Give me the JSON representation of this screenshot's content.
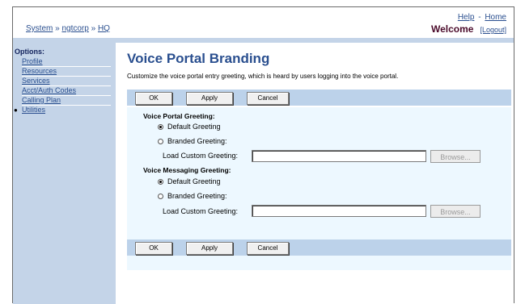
{
  "header": {
    "help": "Help",
    "separator": "-",
    "home": "Home",
    "breadcrumb": [
      "System",
      "ngtcorp",
      "HQ"
    ],
    "breadcrumb_sep": "»",
    "welcome": "Welcome",
    "logout": "[Logout]"
  },
  "sidebar": {
    "title": "Options:",
    "items": [
      {
        "label": "Profile"
      },
      {
        "label": "Resources"
      },
      {
        "label": "Services"
      },
      {
        "label": "Acct/Auth Codes"
      },
      {
        "label": "Calling Plan"
      },
      {
        "label": "Utilities"
      }
    ],
    "active_index": 5
  },
  "main": {
    "title": "Voice Portal Branding",
    "description": "Customize the voice portal entry greeting, which is heard by users logging into the voice portal.",
    "buttons": {
      "ok": "OK",
      "apply": "Apply",
      "cancel": "Cancel"
    },
    "portal": {
      "heading": "Voice Portal Greeting:",
      "default": "Default Greeting",
      "branded": "Branded Greeting:",
      "load_label": "Load Custom Greeting:",
      "load_value": "",
      "browse": "Browse...",
      "selected": "default"
    },
    "messaging": {
      "heading": "Voice Messaging Greeting:",
      "default": "Default Greeting",
      "branded": "Branded Greeting:",
      "load_label": "Load Custom Greeting:",
      "load_value": "",
      "browse": "Browse...",
      "selected": "default"
    }
  }
}
